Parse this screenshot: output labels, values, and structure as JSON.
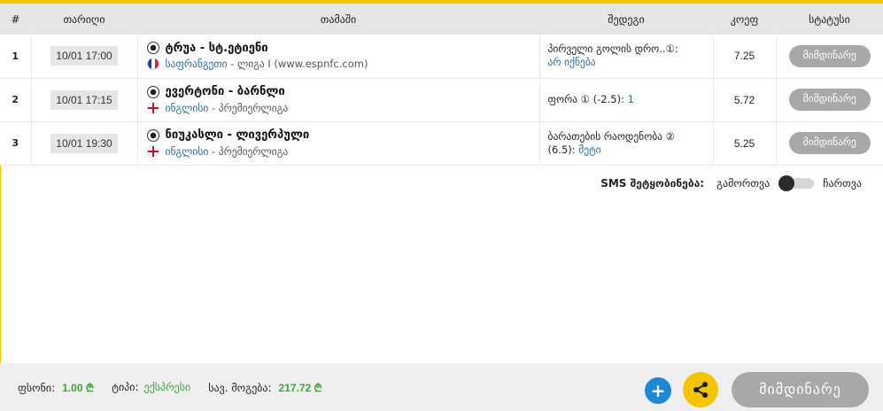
{
  "table": {
    "headers": [
      "#",
      "თარიღი",
      "თამაში",
      "შედეგი",
      "კოეფ",
      "სტატუსი"
    ],
    "rows": [
      {
        "num": "1",
        "date": "10/01 17:00",
        "match": "ტრუა - სტ.ეტიენი",
        "country": "საფრანგეთი",
        "league": "ლიგა I (www.espnfc.com)",
        "bet_text": "პირველი გოლის დრო..①:",
        "bet_value": "არ იქნება",
        "odds": "7.25",
        "status": "მიმდინარე"
      },
      {
        "num": "2",
        "date": "10/01 17:15",
        "match": "ევერტონი - ბარნლი",
        "country": "ინგლისი",
        "league": "პრემიერლიგა",
        "bet_text": "ფორა ① (-2.5):",
        "bet_value": "1",
        "odds": "5.72",
        "status": "მიმდინარე"
      },
      {
        "num": "3",
        "date": "10/01 19:30",
        "match": "ნიუკასლი - ლივერპული",
        "country": "ინგლისი",
        "league": "პრემიერლიგა",
        "bet_text": "ბარათების რაოდენობა ②",
        "bet_text2": "(6.5):",
        "bet_value": "მეტი",
        "odds": "5.25",
        "status": "მიმდინარე"
      }
    ]
  },
  "sms": {
    "label": "SMS შეტყობინება:",
    "off_label": "გამორთვა",
    "on_label": "ჩართვა",
    "enabled": false
  },
  "footer": {
    "stake_label": "ფსონი:",
    "stake_value": "1.00 ₾",
    "type_label": "ტიპი:",
    "type_value": "ექსპრესი",
    "win_label": "სავ. მოგება:",
    "win_value": "217.72 ₾",
    "plus_label": "+",
    "status_label": "მიმდინარე"
  },
  "icons": {
    "ball": "soccer-ball-icon",
    "flag_fr": "france-flag-icon",
    "flag_en": "england-flag-icon",
    "share": "share-icon"
  },
  "colors": {
    "accent": "#f5c400",
    "header_bg": "#e6e6e6",
    "status_pill": "#a8a8a8",
    "link": "#2d6a99",
    "money": "#3aa63a",
    "plus_button": "#1e87d6"
  }
}
